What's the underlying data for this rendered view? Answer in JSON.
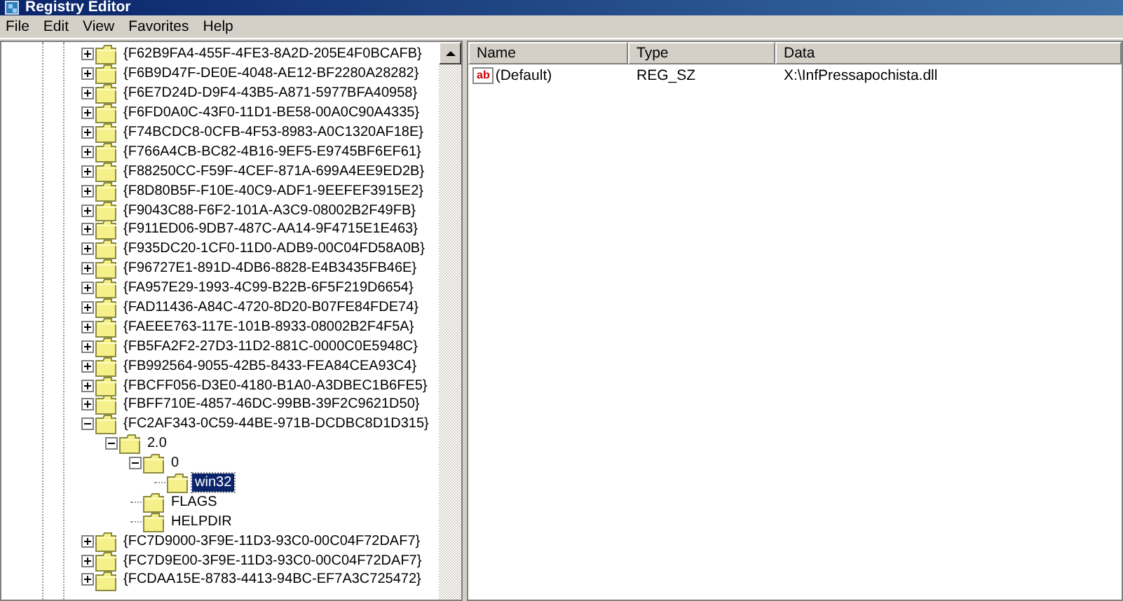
{
  "window": {
    "title": "Registry Editor"
  },
  "menu": [
    "File",
    "Edit",
    "View",
    "Favorites",
    "Help"
  ],
  "tree": {
    "items": [
      {
        "label": "{F62B9FA4-455F-4FE3-8A2D-205E4F0BCAFB}",
        "expandable": true,
        "expanded": false,
        "selected": false
      },
      {
        "label": "{F6B9D47F-DE0E-4048-AE12-BF2280A28282}",
        "expandable": true,
        "expanded": false,
        "selected": false
      },
      {
        "label": "{F6E7D24D-D9F4-43B5-A871-5977BFA40958}",
        "expandable": true,
        "expanded": false,
        "selected": false
      },
      {
        "label": "{F6FD0A0C-43F0-11D1-BE58-00A0C90A4335}",
        "expandable": true,
        "expanded": false,
        "selected": false
      },
      {
        "label": "{F74BCDC8-0CFB-4F53-8983-A0C1320AF18E}",
        "expandable": true,
        "expanded": false,
        "selected": false
      },
      {
        "label": "{F766A4CB-BC82-4B16-9EF5-E9745BF6EF61}",
        "expandable": true,
        "expanded": false,
        "selected": false
      },
      {
        "label": "{F88250CC-F59F-4CEF-871A-699A4EE9ED2B}",
        "expandable": true,
        "expanded": false,
        "selected": false
      },
      {
        "label": "{F8D80B5F-F10E-40C9-ADF1-9EEFEF3915E2}",
        "expandable": true,
        "expanded": false,
        "selected": false
      },
      {
        "label": "{F9043C88-F6F2-101A-A3C9-08002B2F49FB}",
        "expandable": true,
        "expanded": false,
        "selected": false
      },
      {
        "label": "{F911ED06-9DB7-487C-AA14-9F4715E1E463}",
        "expandable": true,
        "expanded": false,
        "selected": false
      },
      {
        "label": "{F935DC20-1CF0-11D0-ADB9-00C04FD58A0B}",
        "expandable": true,
        "expanded": false,
        "selected": false
      },
      {
        "label": "{F96727E1-891D-4DB6-8828-E4B3435FB46E}",
        "expandable": true,
        "expanded": false,
        "selected": false
      },
      {
        "label": "{FA957E29-1993-4C99-B22B-6F5F219D6654}",
        "expandable": true,
        "expanded": false,
        "selected": false
      },
      {
        "label": "{FAD11436-A84C-4720-8D20-B07FE84FDE74}",
        "expandable": true,
        "expanded": false,
        "selected": false
      },
      {
        "label": "{FAEEE763-117E-101B-8933-08002B2F4F5A}",
        "expandable": true,
        "expanded": false,
        "selected": false
      },
      {
        "label": "{FB5FA2F2-27D3-11D2-881C-0000C0E5948C}",
        "expandable": true,
        "expanded": false,
        "selected": false
      },
      {
        "label": "{FB992564-9055-42B5-8433-FEA84CEA93C4}",
        "expandable": true,
        "expanded": false,
        "selected": false
      },
      {
        "label": "{FBCFF056-D3E0-4180-B1A0-A3DBEC1B6FE5}",
        "expandable": true,
        "expanded": false,
        "selected": false
      },
      {
        "label": "{FBFF710E-4857-46DC-99BB-39F2C9621D50}",
        "expandable": true,
        "expanded": false,
        "selected": false
      },
      {
        "label": "{FC2AF343-0C59-44BE-971B-DCDBC8D1D315}",
        "expandable": true,
        "expanded": true,
        "selected": false,
        "children": [
          {
            "label": "2.0",
            "expandable": true,
            "expanded": true,
            "selected": false,
            "children": [
              {
                "label": "0",
                "expandable": true,
                "expanded": true,
                "selected": false,
                "children": [
                  {
                    "label": "win32",
                    "expandable": false,
                    "expanded": false,
                    "selected": true
                  }
                ]
              },
              {
                "label": "FLAGS",
                "expandable": false,
                "expanded": false,
                "selected": false
              },
              {
                "label": "HELPDIR",
                "expandable": false,
                "expanded": false,
                "selected": false
              }
            ]
          }
        ]
      },
      {
        "label": "{FC7D9000-3F9E-11D3-93C0-00C04F72DAF7}",
        "expandable": true,
        "expanded": false,
        "selected": false
      },
      {
        "label": "{FC7D9E00-3F9E-11D3-93C0-00C04F72DAF7}",
        "expandable": true,
        "expanded": false,
        "selected": false
      },
      {
        "label": "{FCDAA15E-8783-4413-94BC-EF7A3C725472}",
        "expandable": true,
        "expanded": false,
        "selected": false
      }
    ]
  },
  "values": {
    "columns": [
      "Name",
      "Type",
      "Data"
    ],
    "rows": [
      {
        "icon_text": "ab",
        "name": "(Default)",
        "type": "REG_SZ",
        "data": "X:\\InfPressapochista.dll"
      }
    ]
  }
}
